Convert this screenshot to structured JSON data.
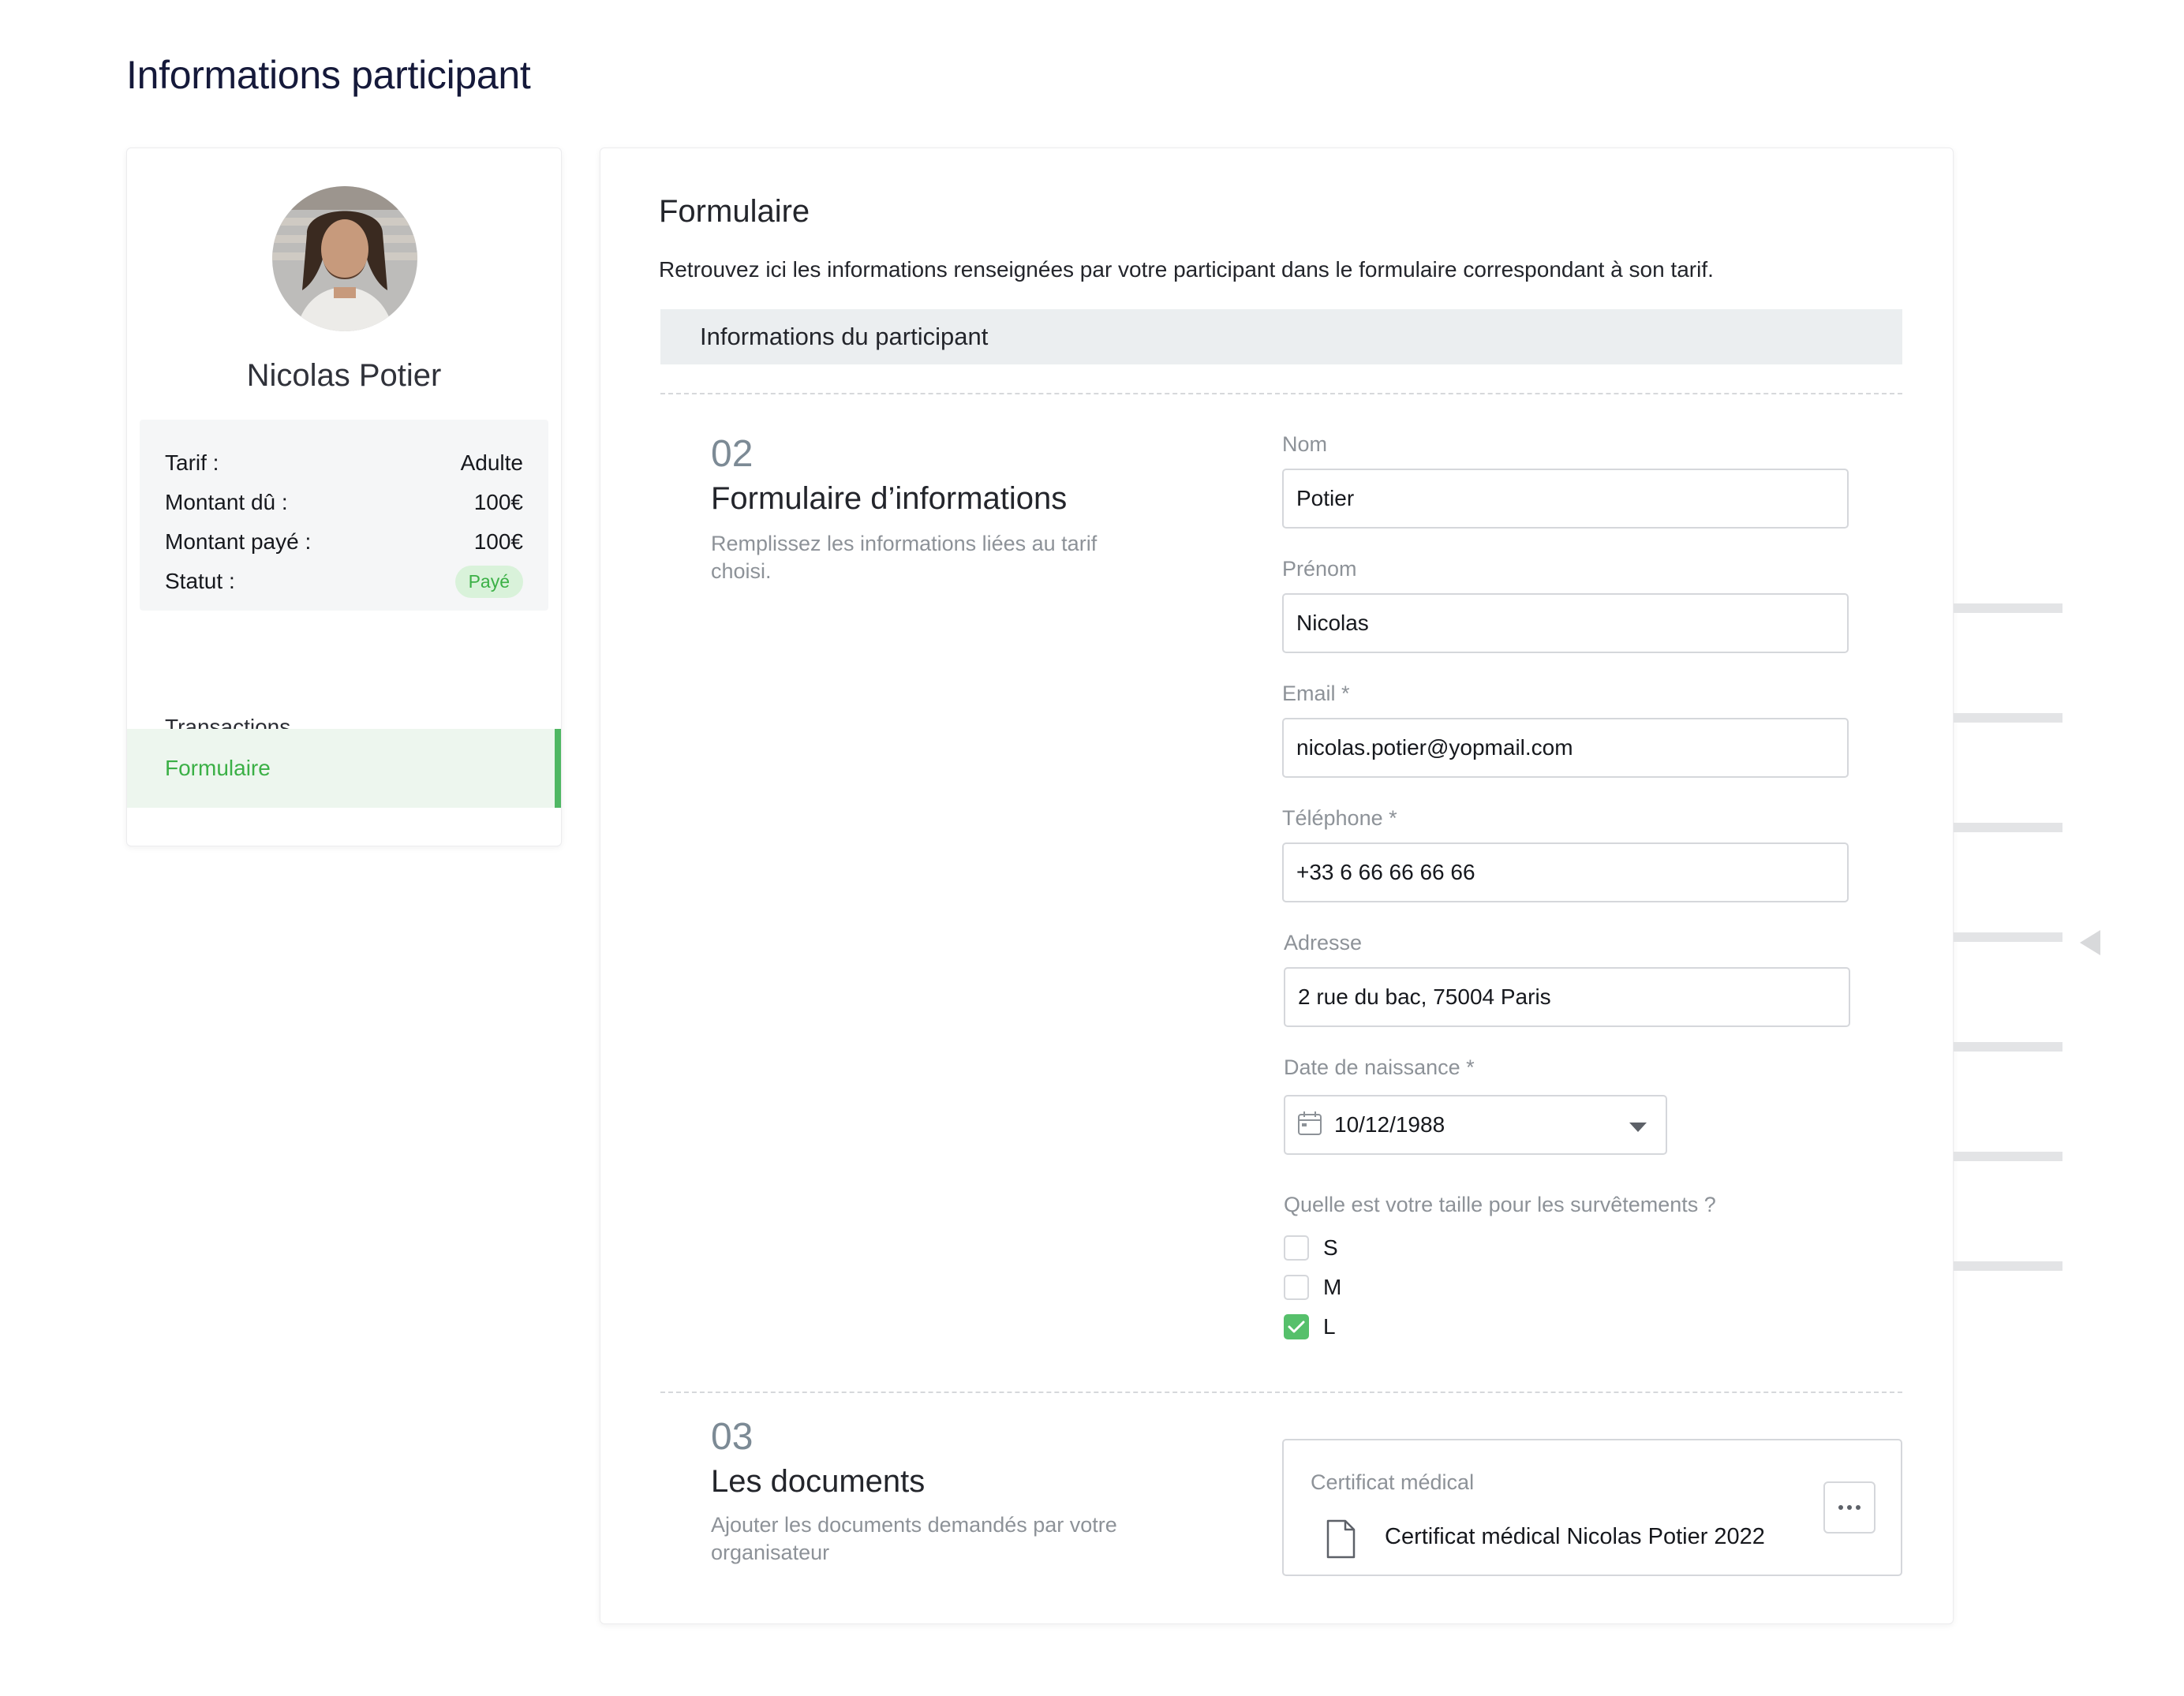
{
  "page": {
    "title": "Informations participant"
  },
  "profile": {
    "name": "Nicolas Potier",
    "summary": [
      {
        "label": "Tarif :",
        "value": "Adulte"
      },
      {
        "label": "Montant dû :",
        "value": "100€"
      },
      {
        "label": "Montant payé :",
        "value": "100€"
      }
    ],
    "status_label": "Statut :",
    "status_value": "Payé",
    "nav": [
      {
        "label": "Transactions",
        "active": false
      },
      {
        "label": "Formulaire",
        "active": true
      }
    ]
  },
  "form": {
    "title": "Formulaire",
    "description": "Retrouvez ici les informations renseignées par votre participant dans le formulaire correspondant à son tarif.",
    "section_title": "Informations du participant",
    "step2": {
      "number": "02",
      "title": "Formulaire d’informations",
      "description": "Remplissez les informations liées au tarif choisi."
    },
    "fields": {
      "nom": {
        "label": "Nom",
        "value": "Potier"
      },
      "prenom": {
        "label": "Prénom",
        "value": "Nicolas"
      },
      "email": {
        "label": "Email *",
        "value": "nicolas.potier@yopmail.com"
      },
      "telephone": {
        "label": "Téléphone *",
        "value": "+33 6 66 66 66 66"
      },
      "adresse": {
        "label": "Adresse",
        "value": "2 rue du bac, 75004 Paris"
      },
      "date_naissance": {
        "label": "Date de naissance *",
        "value": "10/12/1988"
      }
    },
    "size_question": {
      "label": "Quelle est votre taille pour les  survêtements ?",
      "options": [
        {
          "label": "S",
          "checked": false
        },
        {
          "label": "M",
          "checked": false
        },
        {
          "label": "L",
          "checked": true
        }
      ]
    },
    "step3": {
      "number": "03",
      "title": "Les documents",
      "description": "Ajouter les documents demandés par votre organisateur"
    },
    "document": {
      "label": "Certificat médical",
      "file_name": "Certificat médical Nicolas Potier 2022"
    }
  },
  "colors": {
    "accent_green": "#4fb763",
    "badge_bg": "#d9f2da",
    "section_bar_bg": "#ebeef0",
    "title_navy": "#15193a"
  },
  "icons": [
    "calendar-icon",
    "chevron-down-icon",
    "check-icon",
    "file-icon",
    "more-dots-icon",
    "collapse-arrow-icon"
  ]
}
